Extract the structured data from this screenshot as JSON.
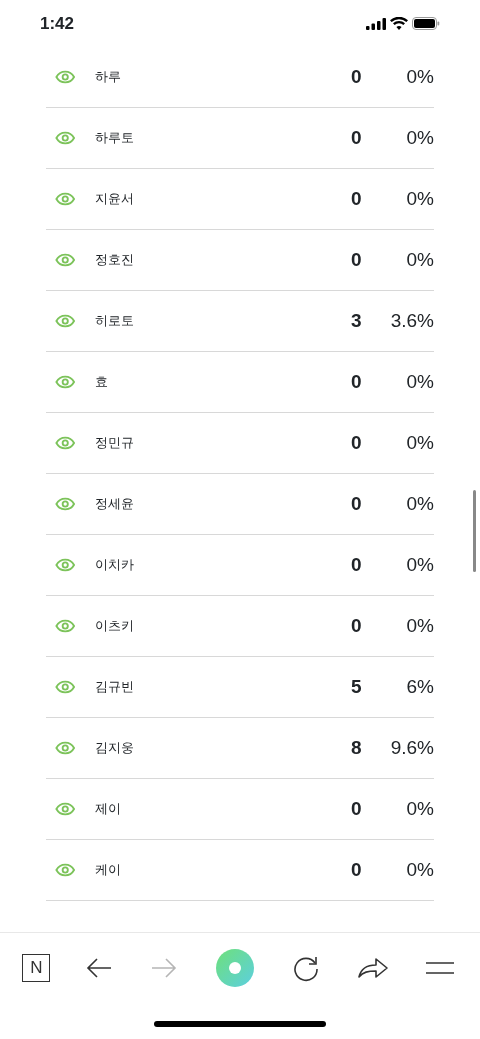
{
  "status_bar": {
    "time": "1:42"
  },
  "rows": [
    {
      "name": "하루",
      "count": "0",
      "percent": "0%"
    },
    {
      "name": "하루토",
      "count": "0",
      "percent": "0%"
    },
    {
      "name": "지윤서",
      "count": "0",
      "percent": "0%"
    },
    {
      "name": "정호진",
      "count": "0",
      "percent": "0%"
    },
    {
      "name": "히로토",
      "count": "3",
      "percent": "3.6%"
    },
    {
      "name": "효",
      "count": "0",
      "percent": "0%"
    },
    {
      "name": "정민규",
      "count": "0",
      "percent": "0%"
    },
    {
      "name": "정세윤",
      "count": "0",
      "percent": "0%"
    },
    {
      "name": "이치카",
      "count": "0",
      "percent": "0%"
    },
    {
      "name": "이츠키",
      "count": "0",
      "percent": "0%"
    },
    {
      "name": "김규빈",
      "count": "5",
      "percent": "6%"
    },
    {
      "name": "김지웅",
      "count": "8",
      "percent": "9.6%"
    },
    {
      "name": "제이",
      "count": "0",
      "percent": "0%"
    },
    {
      "name": "케이",
      "count": "0",
      "percent": "0%"
    }
  ],
  "toolbar": [
    {
      "kind": "home",
      "label": "N",
      "disabled": false
    },
    {
      "kind": "back",
      "disabled": false
    },
    {
      "kind": "forward",
      "disabled": true
    },
    {
      "kind": "green-dot",
      "disabled": false
    },
    {
      "kind": "reload",
      "disabled": false
    },
    {
      "kind": "share",
      "disabled": false
    },
    {
      "kind": "menu",
      "disabled": false
    }
  ]
}
